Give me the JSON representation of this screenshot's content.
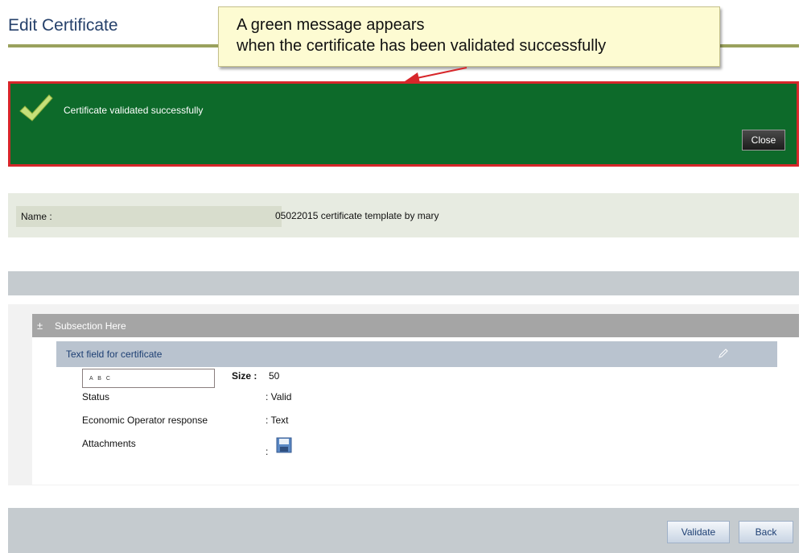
{
  "page": {
    "title": "Edit Certificate"
  },
  "callout": {
    "line1": "A green message appears",
    "line2": "when the certificate has been validated successfully"
  },
  "success": {
    "message": "Certificate validated successfully",
    "close_label": "Close",
    "icon": "checkmark-icon",
    "background": "#0d6a2a",
    "border": "#d7262a"
  },
  "name_row": {
    "label": "Name :",
    "value": "05022015 certificate template by mary"
  },
  "section": {
    "toggle": "±",
    "title": "Subsection Here"
  },
  "field": {
    "title": "Text field for certificate",
    "input_value": "A B C",
    "size_label": "Size :",
    "size_value": "50",
    "rows": [
      {
        "label": "Status",
        "value": ": Valid"
      },
      {
        "label": "Economic Operator response",
        "value": ": Text"
      },
      {
        "label": "Attachments",
        "value": ":"
      }
    ]
  },
  "footer": {
    "validate_label": "Validate",
    "back_label": "Back"
  }
}
